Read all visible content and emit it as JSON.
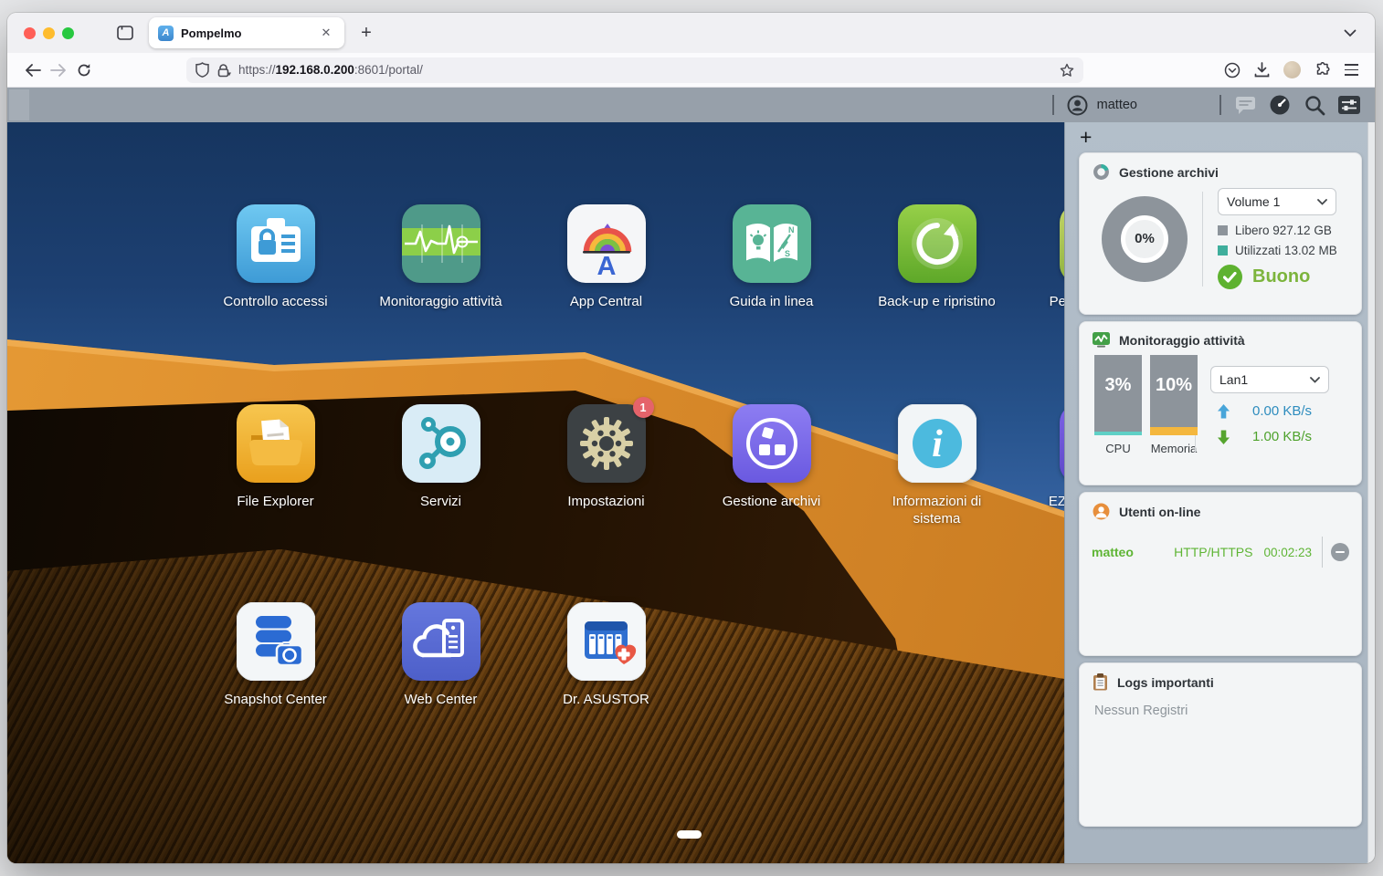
{
  "browser": {
    "tab_title": "Pompelmo",
    "close_tab_glyph": "✕",
    "new_tab_glyph": "+",
    "url_protocol": "https://",
    "url_host": "192.168.0.200",
    "url_rest": ":8601/portal/"
  },
  "adm": {
    "username": "matteo"
  },
  "desktop": {
    "apps": [
      {
        "label": "Controllo accessi"
      },
      {
        "label": "Monitoraggio attività"
      },
      {
        "label": "App Central"
      },
      {
        "label": "Guida in linea"
      },
      {
        "label": "Back-up e ripristino"
      },
      {
        "label": "Pe",
        "cutoff": true
      },
      {
        "label": "File Explorer"
      },
      {
        "label": "Servizi"
      },
      {
        "label": "Impostazioni",
        "badge": "1"
      },
      {
        "label": "Gestione archivi"
      },
      {
        "label": "Informazioni di sistema"
      },
      {
        "label": "EZ",
        "cutoff": true
      },
      {
        "label": "Snapshot Center"
      },
      {
        "label": "Web Center"
      },
      {
        "label": "Dr. ASUSTOR"
      }
    ]
  },
  "sidebar": {
    "add_widget_glyph": "+",
    "storage": {
      "title": "Gestione archivi",
      "usage_percent": "0%",
      "volume": "Volume 1",
      "free": "Libero 927.12 GB",
      "used": "Utilizzati 13.02 MB",
      "status": "Buono"
    },
    "activity": {
      "title": "Monitoraggio attività",
      "cpu_percent": "3%",
      "cpu_label": "CPU",
      "memory_percent": "10%",
      "memory_label": "Memoria",
      "interface": "Lan1",
      "upload_rate": "0.00 KB/s",
      "download_rate": "1.00 KB/s"
    },
    "users": {
      "title": "Utenti on-line",
      "user": "matteo",
      "protocol": "HTTP/HTTPS",
      "session_time": "00:02:23"
    },
    "logs": {
      "title": "Logs importanti",
      "empty_message": "Nessun Registri"
    }
  },
  "colors": {
    "status_good_green": "#7cb43c",
    "used_teal": "#3fae9c",
    "free_gray": "#8d949b",
    "badge_red": "#e5636a",
    "upload_blue": "#2d8cbe",
    "download_green": "#4ea22c",
    "memory_orange": "#f4b73e",
    "cpu_teal": "#5fd0c6",
    "online_user_green": "#5fb535",
    "adm_header_gray": "#97a0aa"
  }
}
